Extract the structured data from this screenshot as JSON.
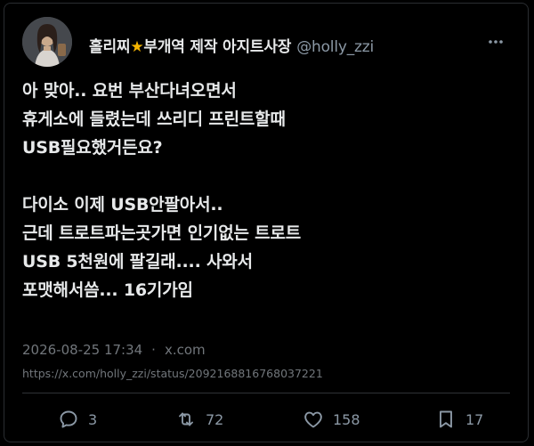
{
  "tweet": {
    "display_name": "홀리찌",
    "display_name_suffix": "부개역 제작 아지트사장",
    "star_icon": "star-icon",
    "handle": "@holly_zzi",
    "body": "아 맞아.. 요번 부산다녀오면서\n휴게소에 들렸는데 쓰리디 프린트할때\nUSB필요했거든요?\n\n다이소 이제 USB안팔아서..\n근데 트로트파는곳가면 인기없는 트로트\nUSB 5천원에 팔길래.... 사와서\n포맷해서씀... 16기가임",
    "timestamp": "2026-08-25 17:34",
    "source": "x.com",
    "status_url": "https://x.com/holly_zzi/status/2092168816768037221"
  },
  "actions": {
    "replies": "3",
    "retweets": "72",
    "likes": "158",
    "bookmarks": "17"
  },
  "icons": {
    "reply": "reply-icon",
    "retweet": "retweet-icon",
    "like": "heart-icon",
    "bookmark": "bookmark-icon",
    "more": "more-icon"
  },
  "colors": {
    "background": "#000000",
    "text": "#e7e9ea",
    "muted": "#71767b",
    "star": "#f4b400"
  }
}
